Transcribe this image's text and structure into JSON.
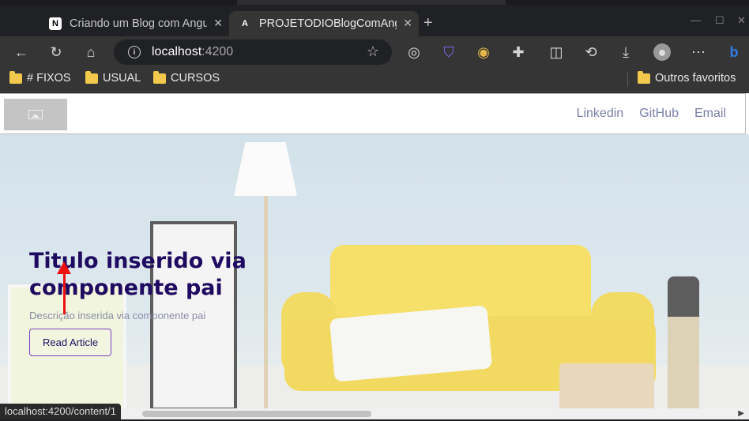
{
  "browser": {
    "tabs": [
      {
        "label": "Criando um Blog com Angular",
        "favicon": "N"
      },
      {
        "label": "PROJETODIOBlogComAngular",
        "favicon": "A"
      }
    ],
    "address": {
      "host": "localhost",
      "port": ":4200"
    },
    "bookmarks": [
      "# FIXOS",
      "USUAL",
      "CURSOS"
    ],
    "other_bookmarks": "Outros favoritos",
    "status_url": "localhost:4200/content/1"
  },
  "site": {
    "nav": [
      "Linkedin",
      "GitHub",
      "Email"
    ],
    "hero": {
      "title": "Titulo inserido via componente pai",
      "description": "Descrição inserida via componente pai",
      "button": "Read Article"
    }
  },
  "colors": {
    "title": "#1e0a60",
    "button_border": "#7b3fc4",
    "nav_link": "#7a7fa8",
    "annotation_arrow": "#e11111"
  }
}
